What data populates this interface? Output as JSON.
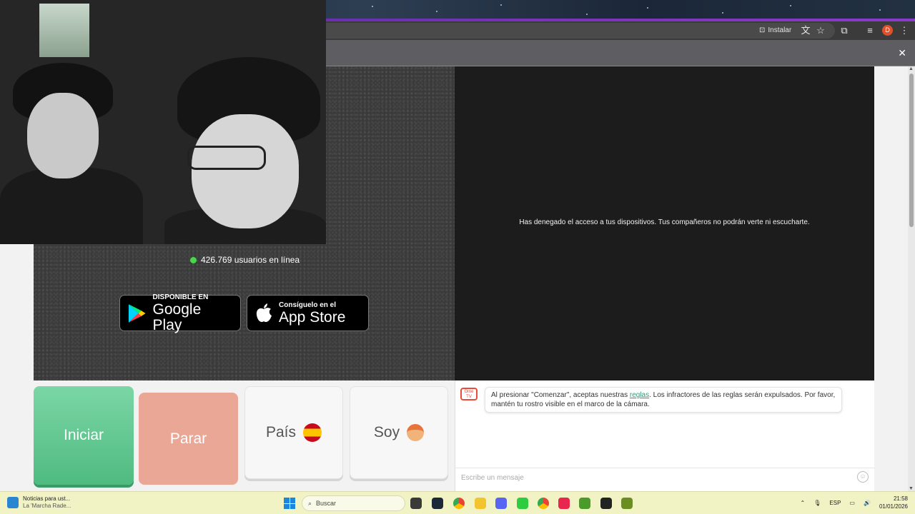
{
  "browser": {
    "install_label": "Instalar",
    "profile_initial": "D",
    "install_icon": "install-icon",
    "translate_icon": "translate-icon",
    "star_icon": "bookmark-star-icon",
    "extensions_icon": "puzzle-icon",
    "media_icon": "media-control-icon",
    "menu_icon": "kebab-menu-icon",
    "infobar_close": "✕"
  },
  "video": {
    "online_count": "426.769 usuarios en línea",
    "denied_message": "Has denegado el acceso a tus dispositivos. Tus compañeros no podrán verte ni escucharte."
  },
  "badges": {
    "google_play": {
      "small": "DISPONIBLE EN",
      "big": "Google Play"
    },
    "app_store": {
      "small": "Consíguelo en el",
      "big": "App Store"
    }
  },
  "controls": {
    "start_label": "Iniciar",
    "stop_label": "Parar",
    "country_label": "País",
    "gender_label": "Soy"
  },
  "chat": {
    "logo_text": "Ome TV",
    "message_before": "Al presionar \"Comenzar\", aceptas nuestras ",
    "rules_link": "reglas",
    "message_after": ". Los infractores de las reglas serán expulsados. Por favor, mantén tu rostro visible en el marco de la cámara.",
    "input_placeholder": "Escribe un mensaje"
  },
  "taskbar": {
    "news_title": "Noticias para ust...",
    "news_subtitle": "La 'Marcha Rade...",
    "search_label": "Buscar",
    "language": "ESP",
    "time": "21:58",
    "date": "01/01/2026"
  },
  "colors": {
    "start_green": "#4fbb80",
    "stop_salmon": "#eaa796",
    "online_green": "#48d74a",
    "link_green": "#2e9a78"
  }
}
